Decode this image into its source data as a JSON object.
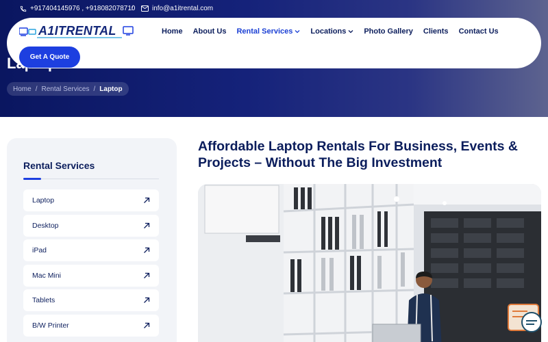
{
  "topbar": {
    "phones": "+917404145976 , +918082078710",
    "separator": "/",
    "email": "info@a1itrental.com"
  },
  "logo": {
    "text": "A1ITRENTAL"
  },
  "nav": {
    "items": [
      {
        "label": "Home"
      },
      {
        "label": "About Us"
      },
      {
        "label": "Rental Services",
        "dropdown": true,
        "active": true
      },
      {
        "label": "Locations",
        "dropdown": true
      },
      {
        "label": "Photo Gallery"
      },
      {
        "label": "Clients"
      },
      {
        "label": "Contact Us"
      }
    ],
    "cta": "Get A Quote"
  },
  "hero": {
    "title": "Laptop on Rent",
    "breadcrumb": [
      "Home",
      "Rental Services",
      "Laptop"
    ],
    "breadcrumb_separator": "/"
  },
  "sidebar": {
    "title": "Rental Services",
    "items": [
      {
        "label": "Laptop"
      },
      {
        "label": "Desktop"
      },
      {
        "label": "iPad"
      },
      {
        "label": "Mac Mini"
      },
      {
        "label": "Tablets"
      },
      {
        "label": "B/W Printer"
      }
    ]
  },
  "main": {
    "headline": "Affordable Laptop Rentals For Business, Events & Projects – Without The Big Investment",
    "photo_alt": "Laptop rental store shelves with laptops and staff member"
  },
  "icons": {
    "phone": "phone-icon",
    "email": "mail-icon",
    "arrow": "arrow-up-right-icon",
    "chevron": "chevron-down-icon"
  },
  "colors": {
    "navy": "#0b1d5c",
    "accent": "#1d3fe0",
    "hero_bg": "#0a1660"
  }
}
